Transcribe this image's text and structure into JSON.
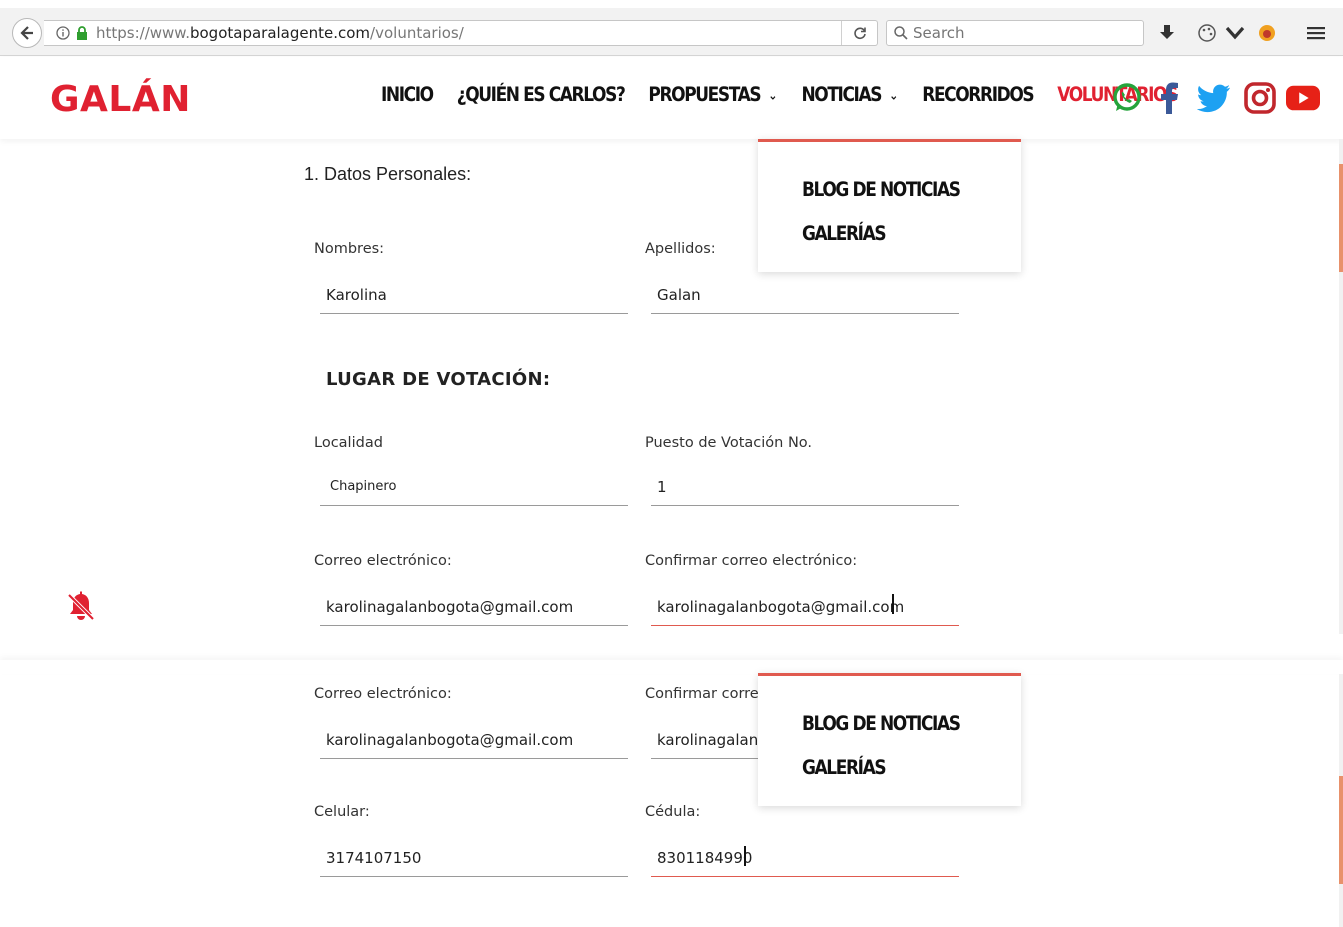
{
  "browser": {
    "url_prefix": "https://www.",
    "url_domain": "bogotaparalagente.com",
    "url_path": "/voluntarios/",
    "search_placeholder": "Search"
  },
  "site": {
    "logo": "GALÁN",
    "nav": [
      {
        "label": "INICIO"
      },
      {
        "label": "¿QUIÉN ES CARLOS?"
      },
      {
        "label": "PROPUESTAS",
        "chevron": "⌄"
      },
      {
        "label": "NOTICIAS",
        "chevron": "⌄"
      },
      {
        "label": "RECORRIDOS"
      },
      {
        "label": "VOLUNTARIOS"
      }
    ],
    "social": [
      "whatsapp-icon",
      "facebook-icon",
      "twitter-icon",
      "instagram-icon",
      "youtube-icon"
    ],
    "dropdown": [
      "BLOG DE NOTICIAS",
      "GALERÍAS"
    ]
  },
  "colors": {
    "brand_red": "#e02131",
    "whatsapp": "#25a33b",
    "facebook": "#3b5998",
    "twitter": "#1da1f2",
    "instagram": "#c1272d",
    "youtube": "#e62117",
    "focus_line": "#e05a4f"
  },
  "form": {
    "section_title": "1. Datos Personales:",
    "nombres": {
      "label": "Nombres:",
      "value": "Karolina"
    },
    "apellidos": {
      "label": "Apellidos:",
      "value": "Galan"
    },
    "voting_heading": "LUGAR DE VOTACIÓN:",
    "localidad": {
      "label": "Localidad",
      "value": "Chapinero"
    },
    "puesto": {
      "label": "Puesto de Votación No.",
      "value": "1"
    },
    "correo": {
      "label": "Correo electrónico:",
      "value": "karolinagalanbogota@gmail.com"
    },
    "confirmar": {
      "label": "Confirmar correo electrónico:",
      "value": "karolinagalanbogota@gmail.com"
    },
    "correo2": {
      "label": "Correo electrónico:",
      "value": "karolinagalanbogota@gmail.com"
    },
    "confirmar2": {
      "label": "Confirmar corre",
      "value": "karolinagalanb"
    },
    "celular": {
      "label": "Celular:",
      "value": "3174107150"
    },
    "cedula": {
      "label": "Cédula:",
      "value": "8301184990"
    }
  }
}
